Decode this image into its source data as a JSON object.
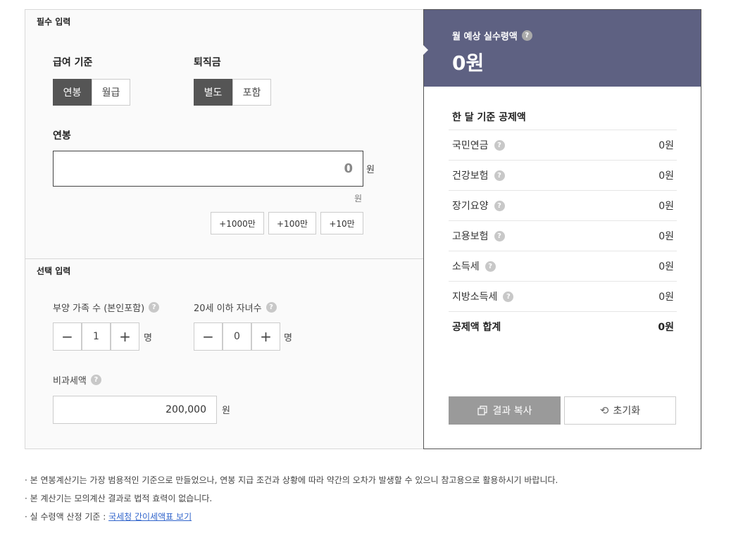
{
  "required": {
    "title": "필수 입력",
    "pay_basis": {
      "label": "급여 기준",
      "options": [
        "연봉",
        "월급"
      ],
      "selected": "연봉"
    },
    "severance": {
      "label": "퇴직금",
      "options": [
        "별도",
        "포함"
      ],
      "selected": "별도"
    },
    "salary": {
      "label": "연봉",
      "value": "0",
      "unit": "원",
      "hint_unit": "원"
    },
    "add_buttons": [
      "+1000만",
      "+100만",
      "+10만"
    ]
  },
  "optional": {
    "title": "선택 입력",
    "dependents": {
      "label": "부양 가족 수 (본인포함)",
      "value": "1",
      "unit": "명"
    },
    "children": {
      "label": "20세 이하 자녀수",
      "value": "0",
      "unit": "명"
    },
    "nontax": {
      "label": "비과세액",
      "value": "200,000",
      "unit": "원"
    }
  },
  "result": {
    "title": "월 예상 실수령액",
    "amount": "0원",
    "deduction_title": "한 달 기준 공제액",
    "rows": [
      {
        "name": "국민연금",
        "value": "0원"
      },
      {
        "name": "건강보험",
        "value": "0원"
      },
      {
        "name": "장기요양",
        "value": "0원"
      },
      {
        "name": "고용보험",
        "value": "0원"
      },
      {
        "name": "소득세",
        "value": "0원"
      },
      {
        "name": "지방소득세",
        "value": "0원"
      }
    ],
    "total": {
      "name": "공제액 합계",
      "value": "0원"
    },
    "copy_label": "결과 복사",
    "reset_label": "초기화"
  },
  "notes": {
    "n1": "· 본 연봉계산기는 가장 범용적인 기준으로 만들었으나, 연봉 지급 조건과 상황에 따라 약간의 오차가 발생할 수 있으니 참고용으로 활용하시기 바랍니다.",
    "n2": "· 본 계산기는 모의계산 결과로 법적 효력이 없습니다.",
    "n3_prefix": "· 실 수령액 산정 기준 : ",
    "n3_link": "국세청 간이세액표 보기"
  },
  "icons": {
    "help": "question-icon",
    "copy": "copy-icon",
    "reset": "reset-icon",
    "minus": "minus-icon",
    "plus": "plus-icon"
  },
  "colors": {
    "header_bg": "#5e6182",
    "selected_bg": "#555555",
    "copy_bg": "#9a9a9a",
    "link": "#3366cc"
  }
}
